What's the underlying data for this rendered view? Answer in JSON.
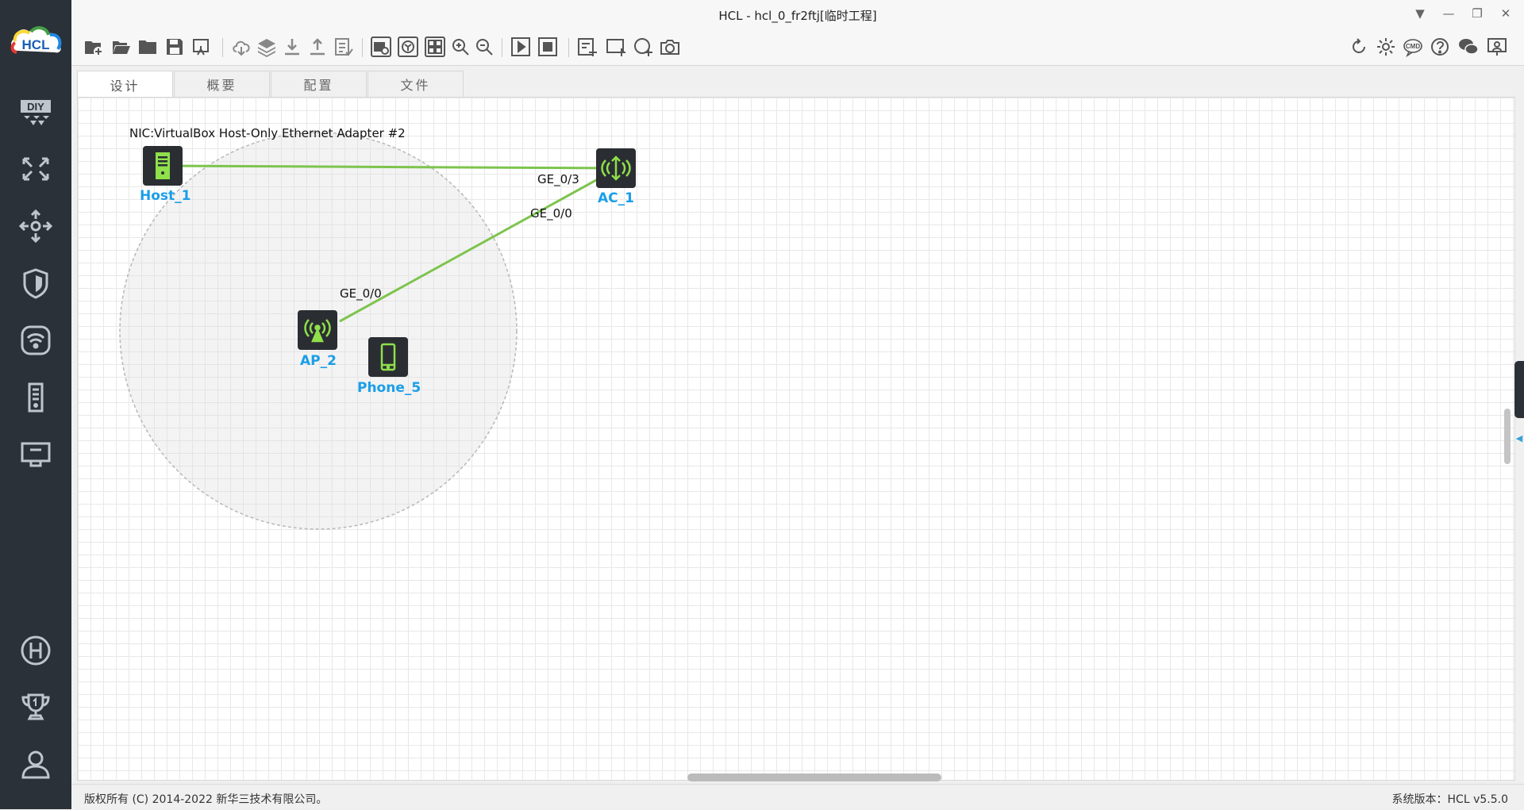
{
  "window": {
    "title": "HCL - hcl_0_fr2ftj[临时工程]"
  },
  "logo": {
    "text": "HCL"
  },
  "sidebar": {
    "items": [
      {
        "icon": "diy-icon"
      },
      {
        "icon": "switch-icon"
      },
      {
        "icon": "router-icon"
      },
      {
        "icon": "firewall-icon"
      },
      {
        "icon": "wireless-icon"
      },
      {
        "icon": "server-icon"
      },
      {
        "icon": "terminal-icon"
      },
      {
        "icon": "h-logo-icon"
      },
      {
        "icon": "trophy-icon"
      },
      {
        "icon": "user-icon"
      }
    ]
  },
  "tabs": [
    {
      "label": "设计",
      "active": true
    },
    {
      "label": "概要",
      "active": false
    },
    {
      "label": "配置",
      "active": false
    },
    {
      "label": "文件",
      "active": false
    }
  ],
  "topology": {
    "nic_label": "NIC:VirtualBox Host-Only Ethernet Adapter #2",
    "nodes": [
      {
        "name": "Host_1",
        "type": "host"
      },
      {
        "name": "AC_1",
        "type": "ac"
      },
      {
        "name": "AP_2",
        "type": "ap"
      },
      {
        "name": "Phone_5",
        "type": "phone"
      }
    ],
    "links": [
      {
        "from": "Host_1",
        "to": "AC_1",
        "to_port": "GE_0/3"
      },
      {
        "from": "AP_2",
        "to": "AC_1",
        "from_port": "GE_0/0",
        "to_port": "GE_0/0"
      }
    ],
    "port_labels": {
      "ac_ge03": "GE_0/3",
      "ac_ge00": "GE_0/0",
      "ap_ge00": "GE_0/0"
    }
  },
  "statusbar": {
    "copyright": "版权所有 (C) 2014-2022 新华三技术有限公司。",
    "version": "系统版本：HCL v5.5.0"
  },
  "colors": {
    "sidebar": "#2b3138",
    "link": "#7dc44e",
    "node_label": "#1a9ee8",
    "node_bg": "#2a2e33",
    "node_icon": "#8fe04a"
  }
}
